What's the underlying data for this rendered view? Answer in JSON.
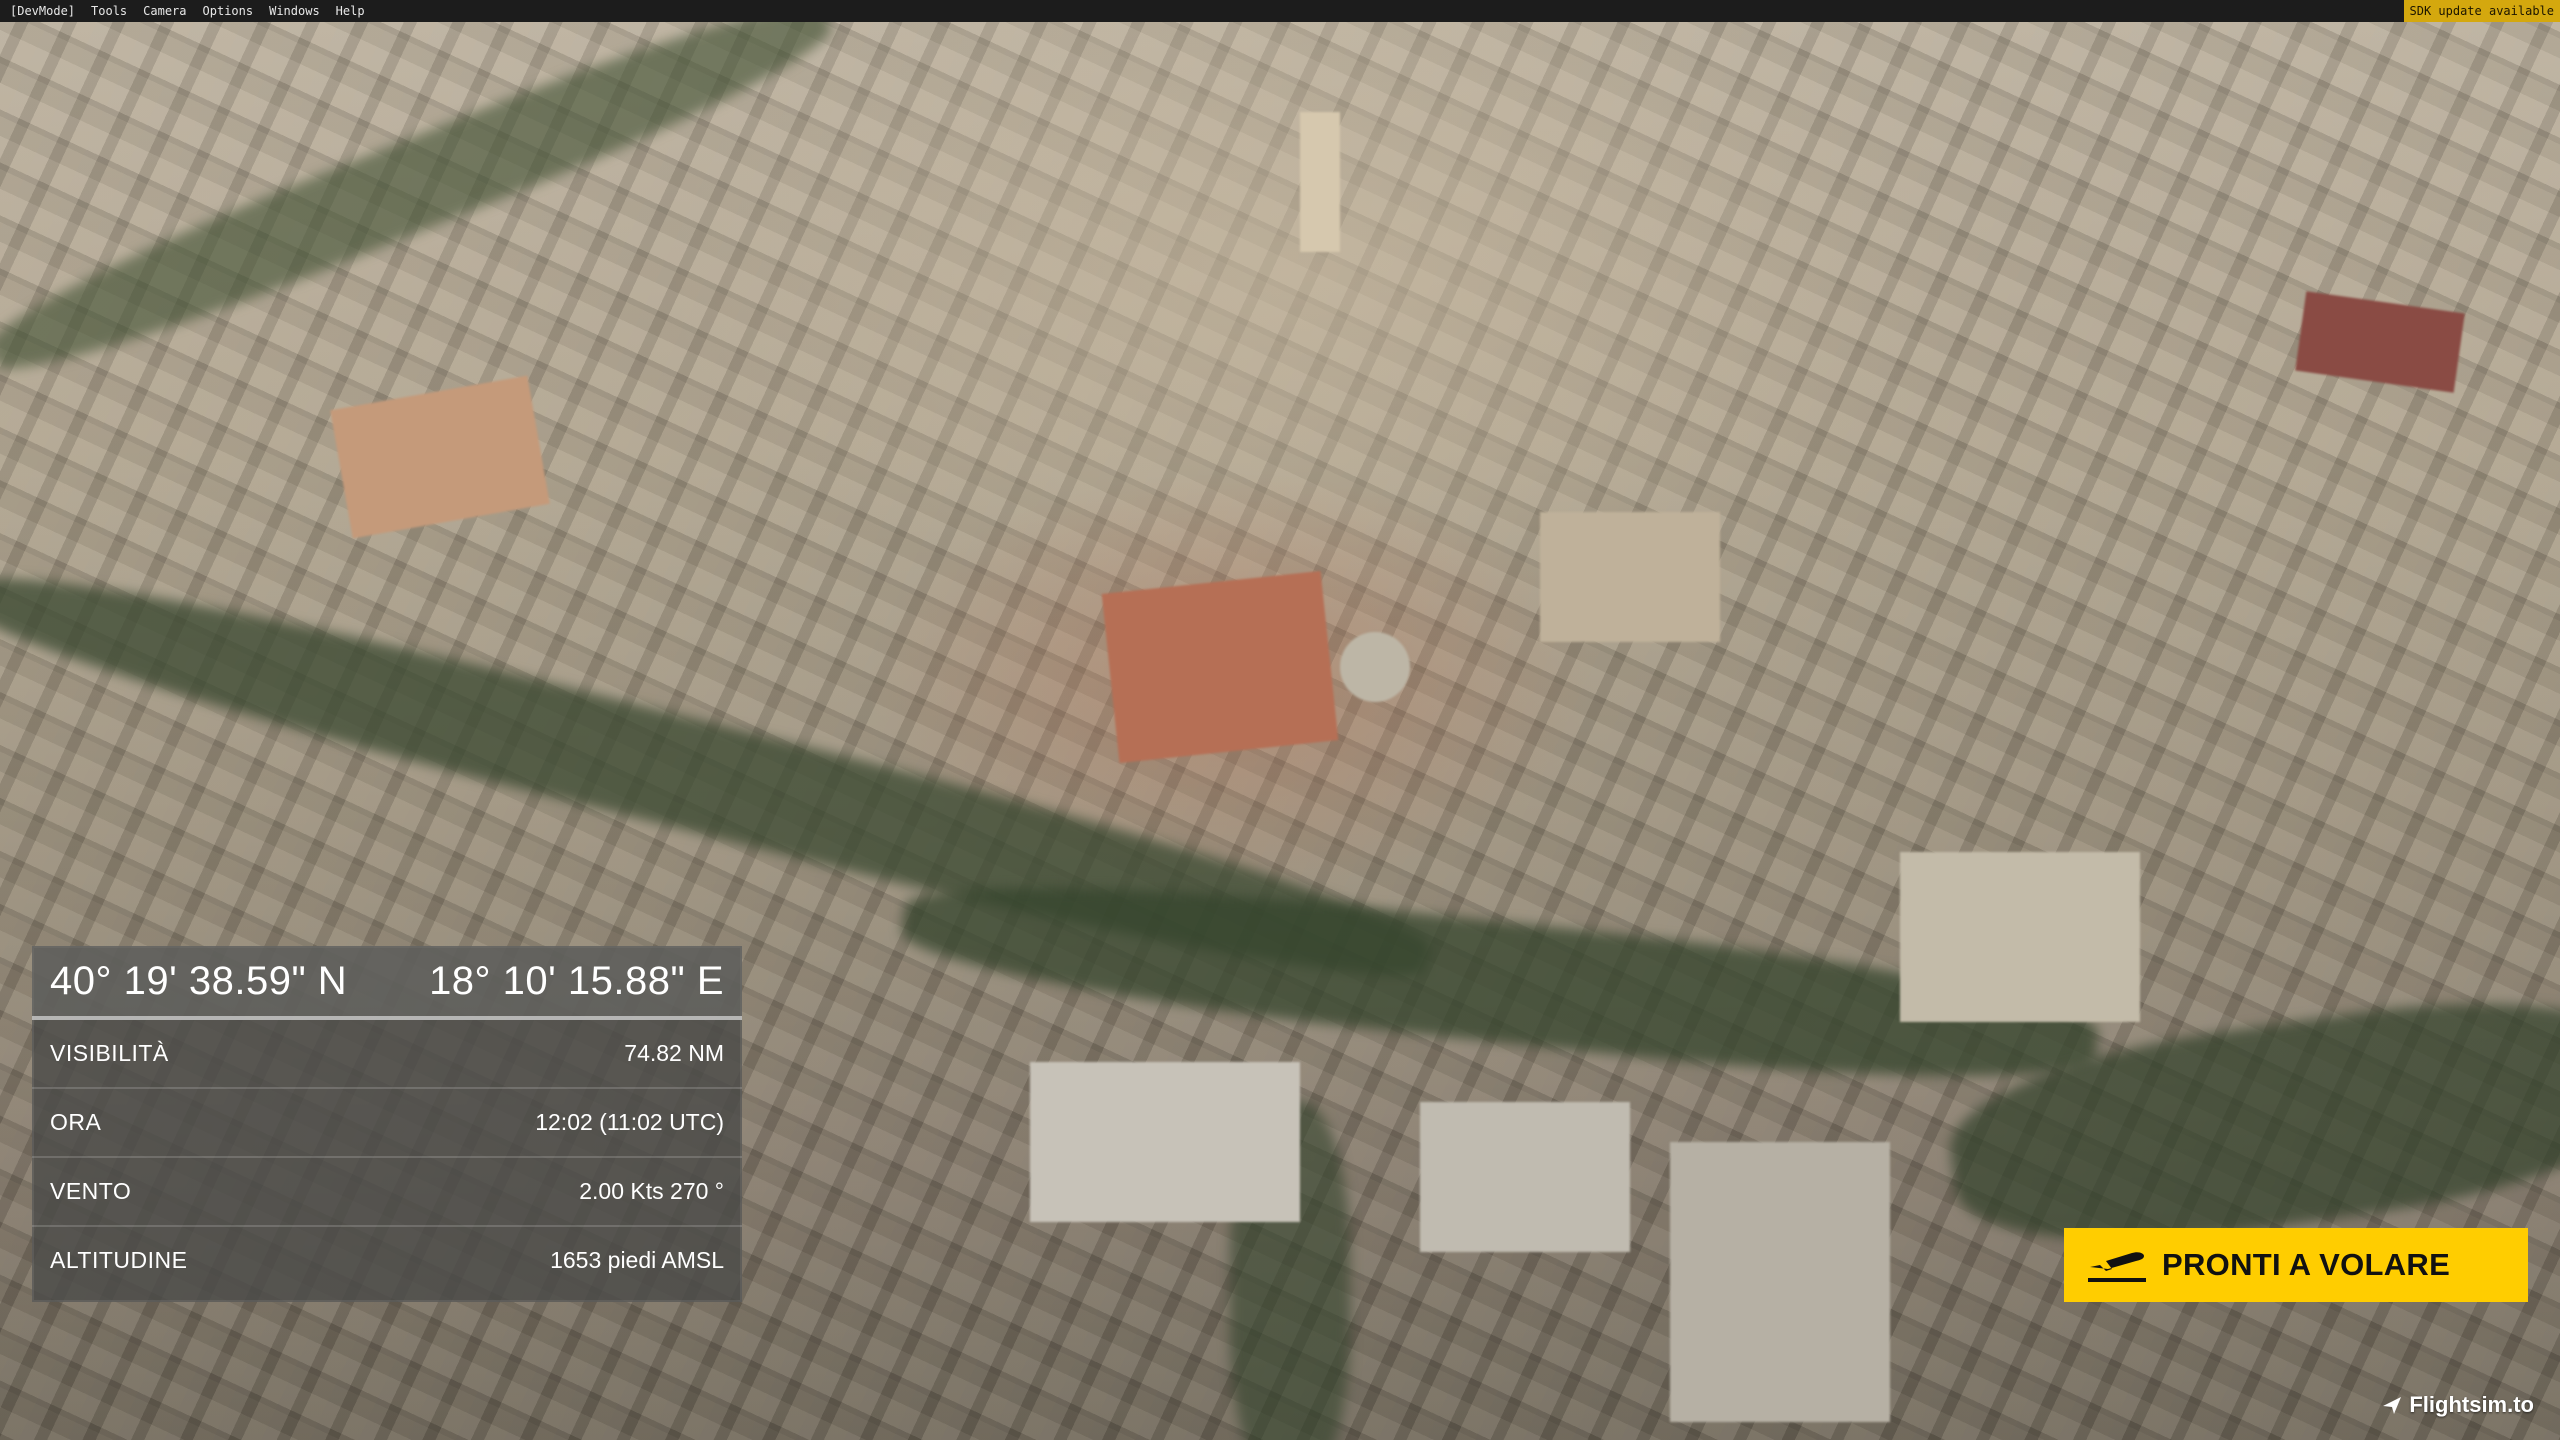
{
  "dev_menu": {
    "items": [
      "[DevMode]",
      "Tools",
      "Camera",
      "Options",
      "Windows",
      "Help"
    ],
    "sdk_notice": "SDK update available"
  },
  "info_panel": {
    "latitude": "40° 19' 38.59\" N",
    "longitude": "18° 10' 15.88\" E",
    "rows": [
      {
        "label": "VISIBILITÀ",
        "value": "74.82 NM"
      },
      {
        "label": "ORA",
        "value": "12:02 (11:02 UTC)"
      },
      {
        "label": "VENTO",
        "value": "2.00 Kts 270 °"
      },
      {
        "label": "ALTITUDINE",
        "value": "1653 piedi AMSL"
      }
    ]
  },
  "ready_button": {
    "label": "PRONTI A VOLARE",
    "icon": "plane-takeoff-icon",
    "color": "#ffcd00"
  },
  "watermark": {
    "text": "Flightsim.to"
  },
  "colors": {
    "dev_bar": "#1c1c1c",
    "sdk_badge": "#d4a80e",
    "panel_bg": "#4a4a48"
  }
}
